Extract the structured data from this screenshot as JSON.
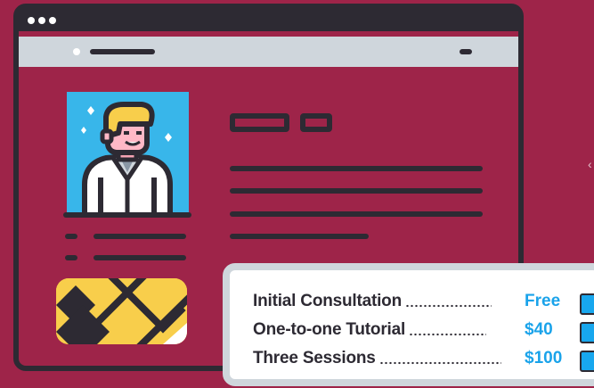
{
  "colors": {
    "background": "#9e2449",
    "window_outline": "#2d2a33",
    "url_bar": "#cfd6dc",
    "photo_background": "#38b6ea",
    "map_background": "#f8ce4b",
    "price_accent": "#1aa3ea"
  },
  "icons": {
    "profile": "person-avatar-icon",
    "map": "map-icon",
    "sparkle": "sparkle-icon",
    "check": "checkbox-icon",
    "chevron": "chevron-left-icon"
  },
  "pricing": [
    {
      "label": "Initial Consultation",
      "price": "Free"
    },
    {
      "label": "One-to-one Tutorial",
      "price": "$40"
    },
    {
      "label": "Three Sessions",
      "price": "$100"
    }
  ],
  "edge_glyph": "‹"
}
